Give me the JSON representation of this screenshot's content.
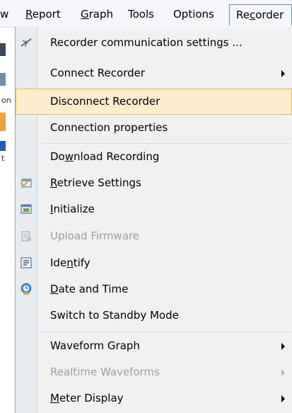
{
  "menubar": {
    "items": [
      {
        "label_pre": "",
        "label_u": "",
        "label_post": "w"
      },
      {
        "label_pre": "",
        "label_u": "R",
        "label_post": "eport"
      },
      {
        "label_pre": "",
        "label_u": "G",
        "label_post": "raph"
      },
      {
        "label_pre": "",
        "label_u": "",
        "label_post": "Tools"
      },
      {
        "label_pre": "",
        "label_u": "",
        "label_post": "Options"
      },
      {
        "label_pre": "Re",
        "label_u": "c",
        "label_post": "order"
      }
    ]
  },
  "recorder_menu": {
    "items": [
      {
        "pre": "Recorder communication settings ...",
        "u": "",
        "post": "",
        "icon": "antenna-icon",
        "submenu": false,
        "disabled": false,
        "highlighted": false
      },
      {
        "pre": "Connect Recorder",
        "u": "",
        "post": "",
        "icon": "",
        "submenu": true,
        "disabled": false,
        "highlighted": false
      },
      {
        "pre": "Disconnect Recorder",
        "u": "",
        "post": "",
        "icon": "",
        "submenu": false,
        "disabled": false,
        "highlighted": true
      },
      {
        "pre": "Connection properties",
        "u": "",
        "post": "",
        "icon": "",
        "submenu": false,
        "disabled": false,
        "highlighted": false
      },
      {
        "pre": "Do",
        "u": "w",
        "post": "nload Recording",
        "icon": "",
        "submenu": false,
        "disabled": false,
        "highlighted": false
      },
      {
        "pre": "",
        "u": "R",
        "post": "etrieve Settings",
        "icon": "retrieve-settings-icon",
        "submenu": false,
        "disabled": false,
        "highlighted": false
      },
      {
        "pre": "",
        "u": "I",
        "post": "nitialize",
        "icon": "initialize-icon",
        "submenu": false,
        "disabled": false,
        "highlighted": false
      },
      {
        "pre": "Upload Firmware",
        "u": "",
        "post": "",
        "icon": "upload-firmware-icon",
        "submenu": false,
        "disabled": true,
        "highlighted": false
      },
      {
        "pre": "Ide",
        "u": "n",
        "post": "tify",
        "icon": "identify-icon",
        "submenu": false,
        "disabled": false,
        "highlighted": false
      },
      {
        "pre": "",
        "u": "D",
        "post": "ate and Time",
        "icon": "clock-icon",
        "submenu": false,
        "disabled": false,
        "highlighted": false
      },
      {
        "pre": "Switch to Standby Mode",
        "u": "",
        "post": "",
        "icon": "",
        "submenu": false,
        "disabled": false,
        "highlighted": false
      },
      {
        "pre": "Waveform Graph",
        "u": "",
        "post": "",
        "icon": "",
        "submenu": true,
        "disabled": false,
        "highlighted": false
      },
      {
        "pre": "Realtime Waveforms",
        "u": "",
        "post": "",
        "icon": "",
        "submenu": true,
        "disabled": true,
        "highlighted": false
      },
      {
        "pre": "",
        "u": "M",
        "post": "eter Display",
        "icon": "",
        "submenu": true,
        "disabled": false,
        "highlighted": false
      }
    ]
  },
  "background_fragments": [
    "on",
    "t"
  ]
}
